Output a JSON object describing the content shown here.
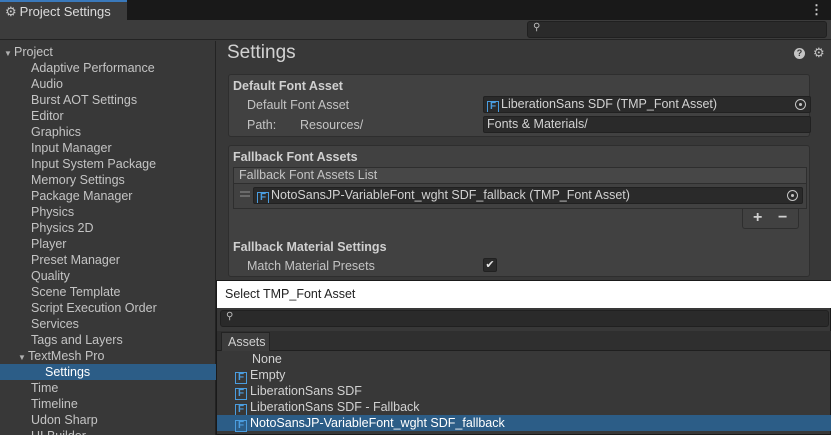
{
  "window": {
    "tab_title": "Project Settings",
    "gear_glyph": "⚙",
    "menu_glyph": "⋮",
    "search_glyph": "⚲"
  },
  "sidebar": {
    "items": [
      {
        "label": "Project",
        "arrow": "▼",
        "indent": 0,
        "selected": false
      },
      {
        "label": "Adaptive Performance",
        "indent": 1,
        "selected": false
      },
      {
        "label": "Audio",
        "indent": 1,
        "selected": false
      },
      {
        "label": "Burst AOT Settings",
        "indent": 1,
        "selected": false
      },
      {
        "label": "Editor",
        "indent": 1,
        "selected": false
      },
      {
        "label": "Graphics",
        "indent": 1,
        "selected": false
      },
      {
        "label": "Input Manager",
        "indent": 1,
        "selected": false
      },
      {
        "label": "Input System Package",
        "indent": 1,
        "selected": false
      },
      {
        "label": "Memory Settings",
        "indent": 1,
        "selected": false
      },
      {
        "label": "Package Manager",
        "indent": 1,
        "selected": false
      },
      {
        "label": "Physics",
        "indent": 1,
        "selected": false
      },
      {
        "label": "Physics 2D",
        "indent": 1,
        "selected": false
      },
      {
        "label": "Player",
        "indent": 1,
        "selected": false
      },
      {
        "label": "Preset Manager",
        "indent": 1,
        "selected": false
      },
      {
        "label": "Quality",
        "indent": 1,
        "selected": false
      },
      {
        "label": "Scene Template",
        "indent": 1,
        "selected": false
      },
      {
        "label": "Script Execution Order",
        "indent": 1,
        "selected": false
      },
      {
        "label": "Services",
        "indent": 1,
        "selected": false
      },
      {
        "label": "Tags and Layers",
        "indent": 1,
        "selected": false
      },
      {
        "label": "TextMesh Pro",
        "arrow": "▼",
        "indent": 1,
        "selected": false
      },
      {
        "label": "Settings",
        "indent": 2,
        "selected": true
      },
      {
        "label": "Time",
        "indent": 1,
        "selected": false
      },
      {
        "label": "Timeline",
        "indent": 1,
        "selected": false
      },
      {
        "label": "Udon Sharp",
        "indent": 1,
        "selected": false
      },
      {
        "label": "UI Builder",
        "indent": 1,
        "selected": false
      }
    ]
  },
  "main": {
    "title": "Settings",
    "help_glyph": "?",
    "default_font": {
      "section_title": "Default Font Asset",
      "asset_label": "Default Font Asset",
      "asset_value": "LiberationSans SDF (TMP_Font Asset)",
      "path_label": "Path:",
      "path_prefix": "Resources/",
      "path_value": "Fonts & Materials/"
    },
    "fallback": {
      "section_title": "Fallback Font Assets",
      "list_header": "Fallback Font Assets List",
      "item_value": "NotoSansJP-VariableFont_wght SDF_fallback (TMP_Font Asset)",
      "plus": "+",
      "minus": "−"
    },
    "fallback_material": {
      "section_title": "Fallback Material Settings",
      "match_label": "Match Material Presets",
      "match_checked": true,
      "check_glyph": "✔"
    }
  },
  "popup": {
    "title": "Select TMP_Font Asset",
    "tab_label": "Assets",
    "font_icon_glyph": "F",
    "items": [
      {
        "label": "None",
        "icon": false,
        "selected": false
      },
      {
        "label": "Empty",
        "icon": true,
        "selected": false
      },
      {
        "label": "LiberationSans SDF",
        "icon": true,
        "selected": false
      },
      {
        "label": "LiberationSans SDF - Fallback",
        "icon": true,
        "selected": false
      },
      {
        "label": "NotoSansJP-VariableFont_wght SDF_fallback",
        "icon": true,
        "selected": true
      }
    ]
  }
}
